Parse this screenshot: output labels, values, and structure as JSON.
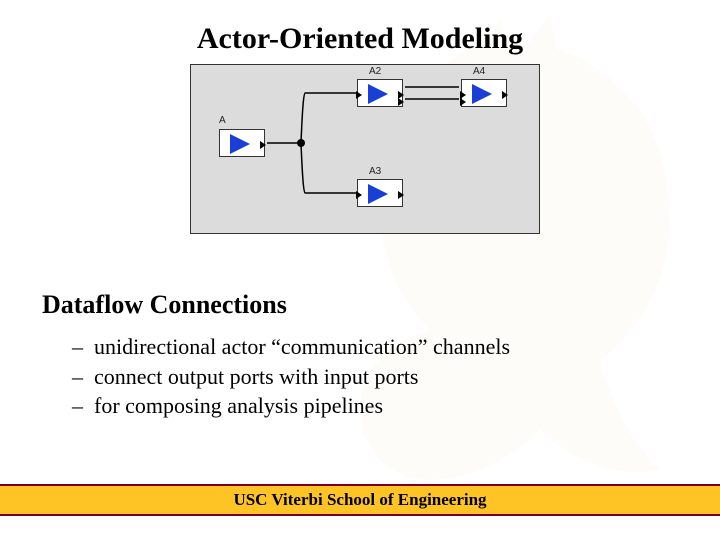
{
  "title": "Actor-Oriented Modeling",
  "diagram": {
    "actors": {
      "a": {
        "label": "A"
      },
      "a2": {
        "label": "A2"
      },
      "a3": {
        "label": "A3"
      },
      "a4": {
        "label": "A4"
      }
    }
  },
  "section": {
    "heading": "Dataflow Connections",
    "bullets": [
      "unidirectional actor “communication” channels",
      "connect output ports with input ports",
      "for composing analysis pipelines"
    ]
  },
  "footer": "USC Viterbi School of Engineering"
}
